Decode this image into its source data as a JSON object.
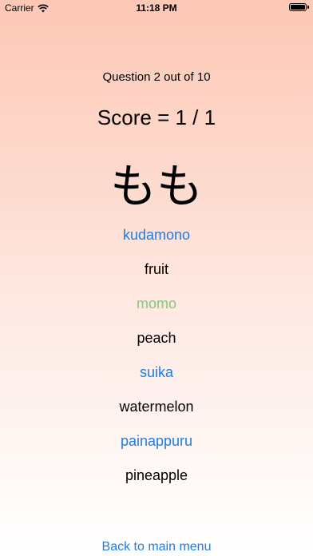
{
  "status_bar": {
    "carrier": "Carrier",
    "time": "11:18 PM",
    "wifi_icon": "wifi-icon",
    "battery_icon": "battery-icon"
  },
  "quiz": {
    "question_text": "Question 2 out of 10",
    "score_text": "Score = 1 / 1",
    "kana": "もも"
  },
  "options": [
    {
      "romaji": "kudamono",
      "english": "fruit",
      "state": "default"
    },
    {
      "romaji": "momo",
      "english": "peach",
      "state": "correct"
    },
    {
      "romaji": "suika",
      "english": "watermelon",
      "state": "default"
    },
    {
      "romaji": "painappuru",
      "english": "pineapple",
      "state": "default"
    }
  ],
  "footer": {
    "back_label": "Back to main menu"
  },
  "colors": {
    "link_blue": "#1e7de1",
    "correct_green": "#86c97c",
    "gradient_top": "#fdc8b6",
    "gradient_bottom": "#ffffff"
  }
}
